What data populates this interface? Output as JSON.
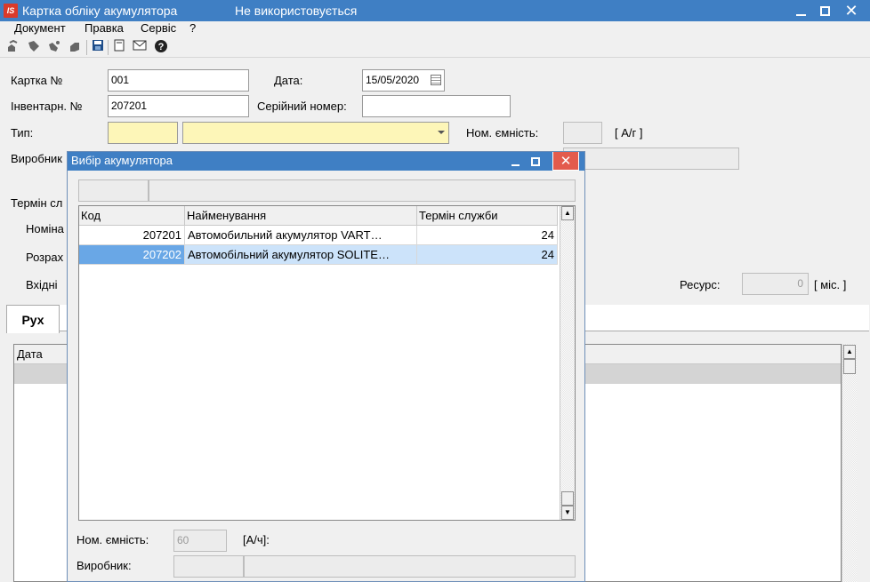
{
  "window": {
    "title": "Картка обліку акумулятора",
    "status": "Не використовується",
    "logo_text": "IS"
  },
  "menu": [
    "Документ",
    "Правка",
    "Сервіс",
    "?"
  ],
  "toolbar_icons": [
    "copy-icon",
    "paste-icon",
    "cut-icon",
    "delete-icon",
    "save-icon",
    "document-icon",
    "mail-icon",
    "help-icon"
  ],
  "form": {
    "card_no_label": "Картка №",
    "card_no": "001",
    "date_label": "Дата:",
    "date": "15/05/2020",
    "inventory_label": "Інвентарн. №",
    "inventory": "207201",
    "serial_label": "Серійний номер:",
    "serial": "",
    "type_label": "Тип:",
    "nominal_capacity_label": "Ном. ємність:",
    "capacity_unit": "[ А/г ]",
    "manufacturer_label": "Виробник",
    "term_label": "Термін сл",
    "nominal_label": "Номіна",
    "calc_label": "Розрах",
    "incoming_label": "Вхідні",
    "resource_label": "Ресурс:",
    "resource_value": "0",
    "resource_unit": "[ міс. ]"
  },
  "tabs": [
    {
      "label": "Рух"
    }
  ],
  "main_grid": {
    "columns": [
      "Дата"
    ]
  },
  "dialog": {
    "title": "Вибір акумулятора",
    "columns": [
      "Код",
      "Найменування",
      "Термін служби"
    ],
    "rows": [
      {
        "code": "207201",
        "name": "Автомобильний акумулятор VART…",
        "term": "24",
        "selected": false
      },
      {
        "code": "207202",
        "name": "Автомобільний акумулятор SOLITE…",
        "term": "24",
        "selected": true
      }
    ],
    "capacity_label": "Ном. ємність:",
    "capacity_value": "60",
    "capacity_unit": "[А/ч]:",
    "manufacturer_label": "Виробник:"
  },
  "colors": {
    "titlebar": "#3f7fc4",
    "close_button": "#e35b4d",
    "required_field": "#fdf6b8",
    "selection": "#cce3fa",
    "selection_key": "#69a7e6"
  }
}
